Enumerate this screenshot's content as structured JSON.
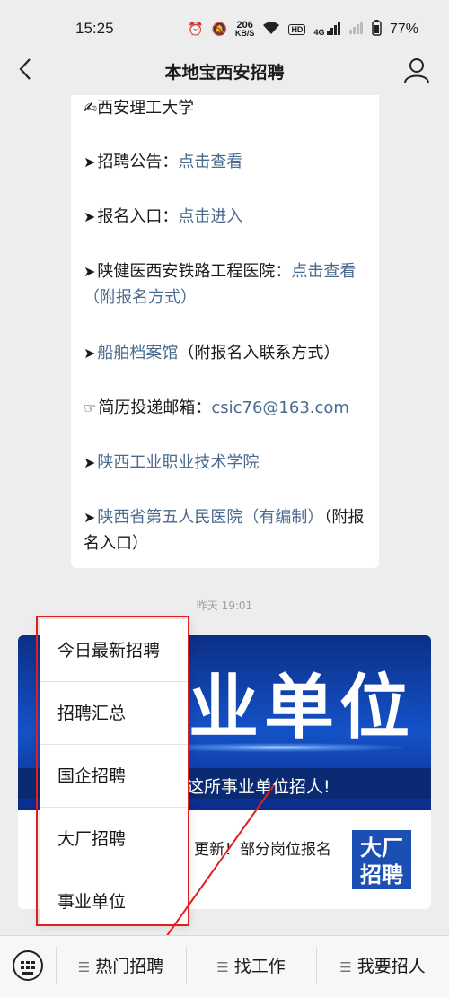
{
  "status_bar": {
    "time": "15:25",
    "net_speed_top": "206",
    "net_speed_bottom": "KB/S",
    "hd_label": "HD",
    "signal_label": "4G",
    "battery": "77%"
  },
  "nav": {
    "title": "本地宝西安招聘"
  },
  "article": {
    "lines": [
      {
        "prefix": "✍",
        "text": "西安理工大学",
        "link": ""
      },
      {
        "prefix": "➤",
        "text": "招聘公告：",
        "link": "点击查看"
      },
      {
        "prefix": "➤",
        "text": "报名入口：",
        "link": "点击进入"
      },
      {
        "prefix": "➤",
        "text": "陕健医西安铁路工程医院：",
        "link": "点击查看（附报名方式）"
      },
      {
        "prefix": "➤",
        "text": "",
        "link": "船舶档案馆",
        "suffix": "（附报名入联系方式）"
      },
      {
        "prefix": "☞",
        "text": "简历投递邮箱：",
        "link": "csic76@163.com"
      },
      {
        "prefix": "➤",
        "text": "",
        "link": "陕西工业职业技术学院"
      },
      {
        "prefix": "➤",
        "text": "",
        "link": "陕西省第五人民医院（有编制）",
        "suffix": "（附报名入口）"
      }
    ]
  },
  "timestamp": "昨天 19:01",
  "card2": {
    "banner_big": "业单位",
    "banner_sub": "这所事业单位招人!",
    "desc": "更新！部分岗位报名",
    "thumb_line1": "大厂",
    "thumb_line2": "招聘"
  },
  "popup_menu": {
    "items": [
      "今日最新招聘",
      "招聘汇总",
      "国企招聘",
      "大厂招聘",
      "事业单位"
    ]
  },
  "bottom_bar": {
    "tabs": [
      "热门招聘",
      "找工作",
      "我要招人"
    ]
  },
  "colors": {
    "link": "#4a6a8f",
    "highlight_red": "#e01e1e",
    "banner_blue": "#1452c8"
  }
}
